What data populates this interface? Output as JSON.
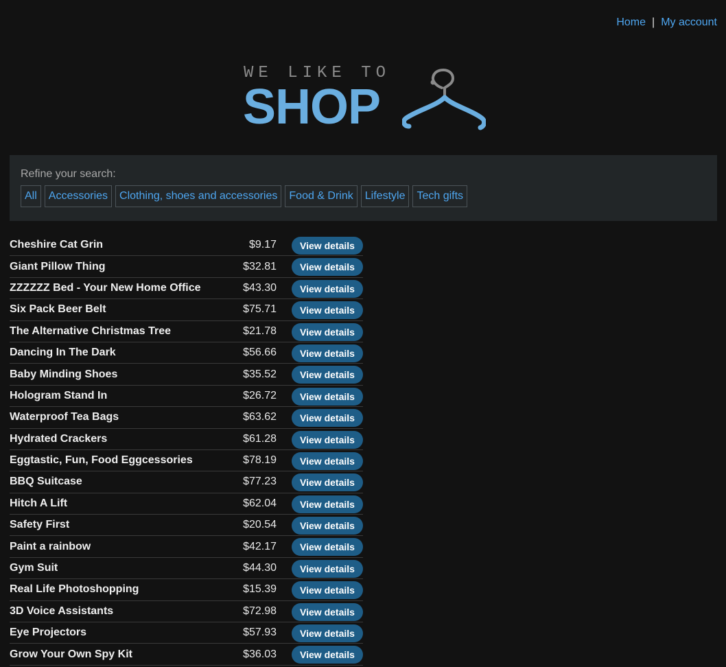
{
  "nav": {
    "home": "Home",
    "separator": "|",
    "account": "My account"
  },
  "logo": {
    "tagline": "WE LIKE TO",
    "name": "SHOP"
  },
  "filter": {
    "label": "Refine your search:",
    "categories": [
      "All",
      "Accessories",
      "Clothing, shoes and accessories",
      "Food & Drink",
      "Lifestyle",
      "Tech gifts"
    ]
  },
  "button_label": "View details",
  "products": [
    {
      "name": "Cheshire Cat Grin",
      "price": "$9.17"
    },
    {
      "name": "Giant Pillow Thing",
      "price": "$32.81"
    },
    {
      "name": "ZZZZZZ Bed - Your New Home Office",
      "price": "$43.30"
    },
    {
      "name": "Six Pack Beer Belt",
      "price": "$75.71"
    },
    {
      "name": "The Alternative Christmas Tree",
      "price": "$21.78"
    },
    {
      "name": "Dancing In The Dark",
      "price": "$56.66"
    },
    {
      "name": "Baby Minding Shoes",
      "price": "$35.52"
    },
    {
      "name": "Hologram Stand In",
      "price": "$26.72"
    },
    {
      "name": "Waterproof Tea Bags",
      "price": "$63.62"
    },
    {
      "name": "Hydrated Crackers",
      "price": "$61.28"
    },
    {
      "name": "Eggtastic, Fun, Food Eggcessories",
      "price": "$78.19"
    },
    {
      "name": "BBQ Suitcase",
      "price": "$77.23"
    },
    {
      "name": "Hitch A Lift",
      "price": "$62.04"
    },
    {
      "name": "Safety First",
      "price": "$20.54"
    },
    {
      "name": "Paint a rainbow",
      "price": "$42.17"
    },
    {
      "name": "Gym Suit",
      "price": "$44.30"
    },
    {
      "name": "Real Life Photoshopping",
      "price": "$15.39"
    },
    {
      "name": "3D Voice Assistants",
      "price": "$72.98"
    },
    {
      "name": "Eye Projectors",
      "price": "$57.93"
    },
    {
      "name": "Grow Your Own Spy Kit",
      "price": "$36.03"
    }
  ],
  "colors": {
    "background": "#121212",
    "link": "#4ea6f0",
    "logo_blue": "#6aaee0",
    "button": "#1e5d87",
    "panel": "#222628"
  }
}
